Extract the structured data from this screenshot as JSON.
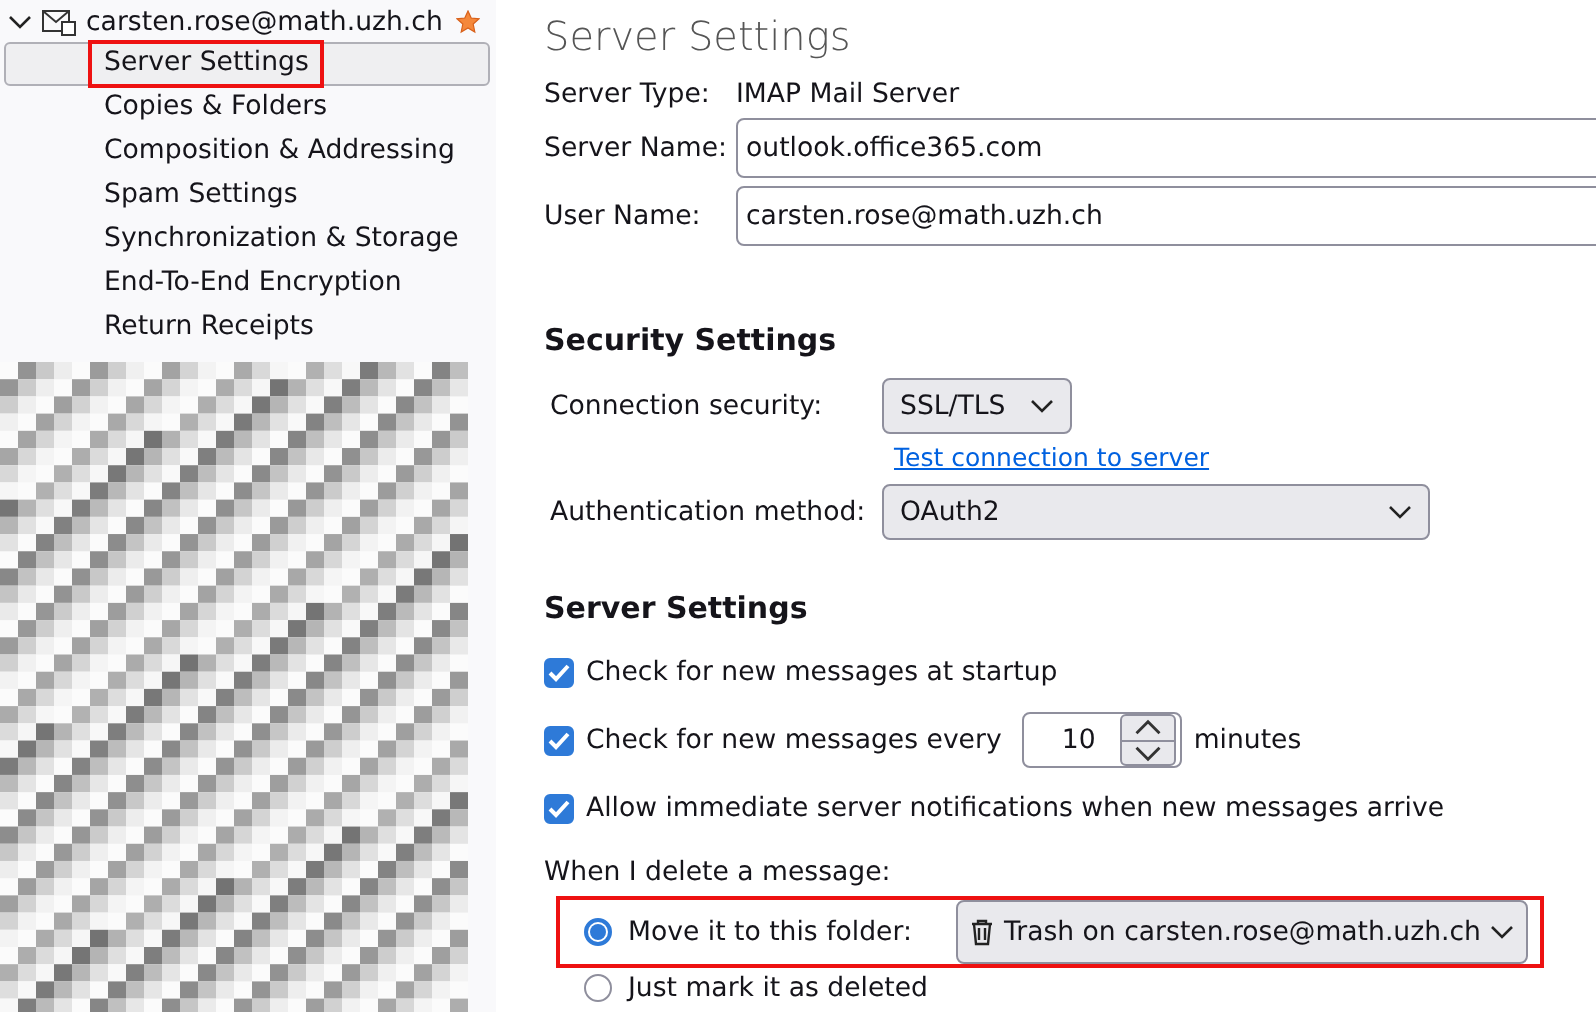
{
  "sidebar": {
    "account": {
      "label": "carsten.rose@math.uzh.ch",
      "expanded": true,
      "default": true
    },
    "items": [
      {
        "label": "Server Settings",
        "selected": true,
        "highlighted": true
      },
      {
        "label": "Copies & Folders",
        "selected": false,
        "highlighted": false
      },
      {
        "label": "Composition & Addressing",
        "selected": false,
        "highlighted": false
      },
      {
        "label": "Spam Settings",
        "selected": false,
        "highlighted": false
      },
      {
        "label": "Synchronization & Storage",
        "selected": false,
        "highlighted": false
      },
      {
        "label": "End-To-End Encryption",
        "selected": false,
        "highlighted": false
      },
      {
        "label": "Return Receipts",
        "selected": false,
        "highlighted": false
      }
    ]
  },
  "page": {
    "title": "Server Settings",
    "server_type": {
      "label": "Server Type:",
      "value": "IMAP Mail Server"
    },
    "server_name": {
      "label": "Server Name:",
      "value": "outlook.office365.com"
    },
    "user_name": {
      "label": "User Name:",
      "value": "carsten.rose@math.uzh.ch"
    },
    "security": {
      "heading": "Security Settings",
      "connection_security": {
        "label": "Connection security:",
        "value": "SSL/TLS"
      },
      "test_link": "Test connection to server",
      "auth_method": {
        "label": "Authentication method:",
        "value": "OAuth2"
      }
    },
    "server_settings": {
      "heading": "Server Settings",
      "options": [
        {
          "kind": "checkbox",
          "label": "Check for new messages at startup",
          "checked": true
        },
        {
          "kind": "interval",
          "label": "Check for new messages every",
          "checked": true,
          "value": "10",
          "unit": "minutes"
        },
        {
          "kind": "checkbox",
          "label": "Allow immediate server notifications when new messages arrive",
          "checked": true
        }
      ],
      "delete_label": "When I delete a message:",
      "delete_options": [
        {
          "label": "Move it to this folder:",
          "selected": true,
          "highlighted": true,
          "folder": "Trash on carsten.rose@math.uzh.ch"
        },
        {
          "label": "Just mark it as deleted",
          "selected": false,
          "highlighted": false
        }
      ]
    }
  }
}
